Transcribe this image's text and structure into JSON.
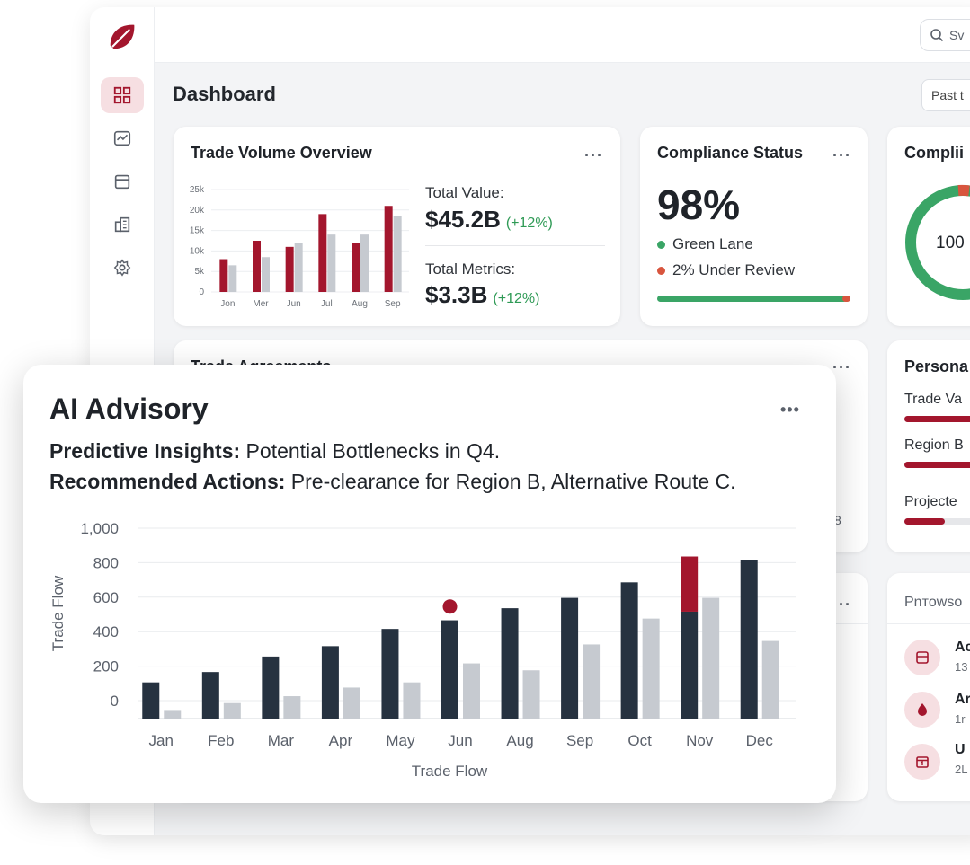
{
  "topbar": {
    "search_placeholder": "Sv"
  },
  "page": {
    "title": "Dashboard",
    "date_filter": "Past t"
  },
  "colors": {
    "accent": "#a3162d",
    "dark_bar": "#263240",
    "light_bar": "#c6cad0",
    "green": "#3aa566"
  },
  "sidebar": {
    "items": [
      {
        "icon": "dashboard-icon",
        "active": true
      },
      {
        "icon": "activity-icon"
      },
      {
        "icon": "calendar-icon"
      },
      {
        "icon": "building-icon"
      },
      {
        "icon": "settings-icon"
      }
    ]
  },
  "trade_volume": {
    "title": "Trade Volume Overview",
    "more": "···",
    "total_value_label": "Total Value:",
    "total_value": "$45.2B",
    "total_value_delta": "(+12%)",
    "total_metrics_label": "Total Metrics:",
    "total_metrics": "$3.3B",
    "total_metrics_delta": "(+12%)",
    "chart_data": {
      "type": "bar",
      "categories": [
        "Jan",
        "Mar",
        "Jun",
        "Jul",
        "Aug",
        "Sep"
      ],
      "tick_labels": [
        "Jon",
        "Mer",
        "Jun",
        "Jul",
        "Aug",
        "Sep"
      ],
      "series": [
        {
          "values": [
            8000,
            12500,
            11000,
            19000,
            12000,
            21000
          ]
        },
        {
          "values": [
            6500,
            8500,
            12000,
            14000,
            14000,
            18500
          ]
        }
      ],
      "y_ticks": [
        "25k",
        "20k",
        "15k",
        "10k",
        "5k",
        "0"
      ],
      "ylim": [
        0,
        25000
      ],
      "grid": true
    }
  },
  "compliance": {
    "title": "Compliance Status",
    "more": "···",
    "percent": "98%",
    "green_lane_label": "Green Lane",
    "review_label": "2% Under Review",
    "green_fraction": 0.98
  },
  "compliance_score": {
    "title": "Complii",
    "center": "100"
  },
  "trade_agreements": {
    "title": "Trade Agreements",
    "more": "···",
    "side_text": "8"
  },
  "personal": {
    "title": "Persona",
    "items": [
      {
        "label": "Trade Va",
        "fraction": 0.9
      },
      {
        "label": "Region B",
        "fraction": 0.85
      },
      {
        "label": "Projecte",
        "fraction": 0.45
      }
    ]
  },
  "lower_card": {
    "more": "···"
  },
  "processes": {
    "title": "Pnтowso",
    "items": [
      {
        "icon": "box-icon",
        "title": "Ac",
        "sub": "13"
      },
      {
        "icon": "drop-icon",
        "title": "Ar",
        "sub": "1r"
      },
      {
        "icon": "calendar-icon",
        "title": "U",
        "sub": "2L"
      }
    ]
  },
  "advisory": {
    "title": "AI Advisory",
    "more": "•••",
    "insights_label": "Predictive Insights:",
    "insights_text": " Potential Bottlenecks in Q4.",
    "actions_label": "Recommended Actions:",
    "actions_text": " Pre-clearance for Region B, Alternative Route C.",
    "chart_data": {
      "type": "bar",
      "xlabel": "Trade Flow",
      "ylabel": "Trade Flow",
      "ylim": [
        0,
        1000
      ],
      "y_ticks": [
        "1,000",
        "800",
        "600",
        "400",
        "200",
        "0"
      ],
      "categories": [
        "Jan",
        "Feb",
        "Mar",
        "Apr",
        "May",
        "Jun",
        "Aug",
        "Sep",
        "Oct",
        "Nov",
        "Dec"
      ],
      "series": [
        {
          "values": [
            210,
            270,
            360,
            420,
            520,
            570,
            640,
            700,
            790,
            620,
            920
          ]
        },
        {
          "values": [
            50,
            90,
            130,
            180,
            210,
            320,
            280,
            430,
            580,
            700,
            450
          ]
        }
      ],
      "highlight": {
        "category": "Nov",
        "from": 620,
        "to": 940
      },
      "marker": {
        "category": "Jun",
        "value": 650
      },
      "grid": true
    }
  }
}
